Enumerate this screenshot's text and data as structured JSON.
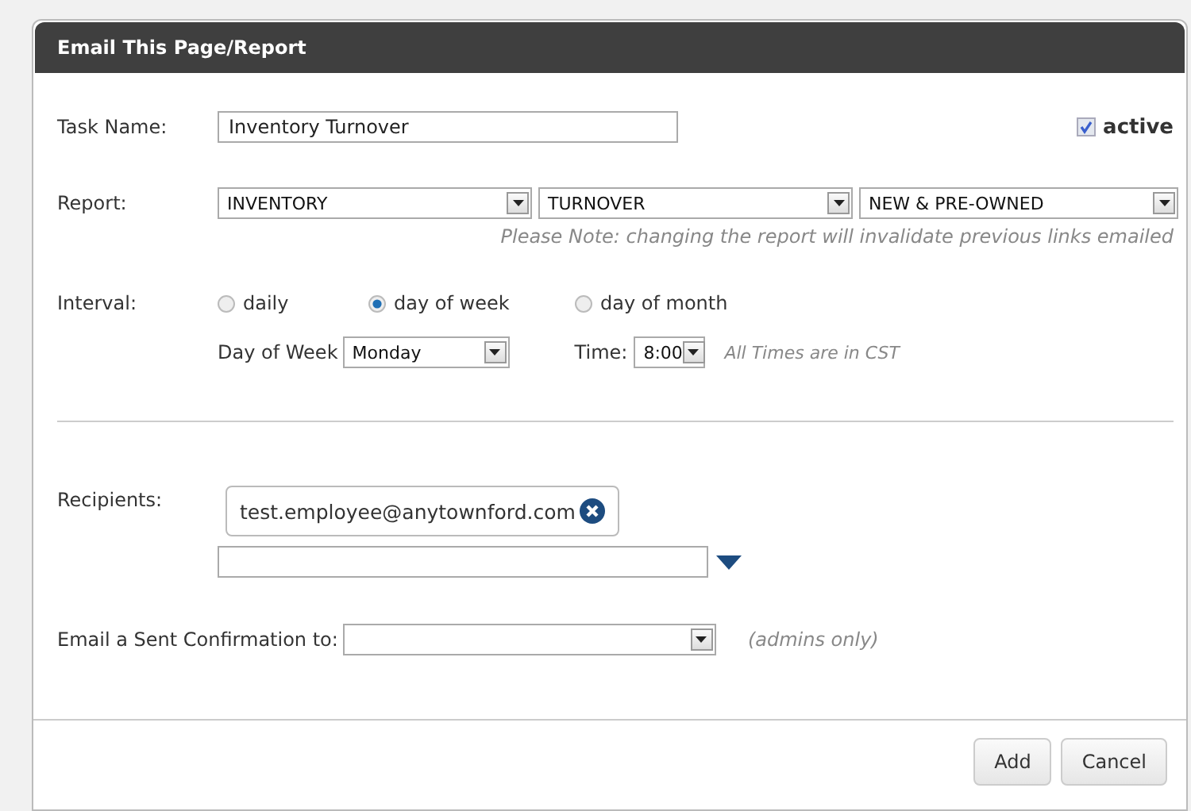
{
  "dialog": {
    "title": "Email This Page/Report"
  },
  "task_name": {
    "label": "Task Name:",
    "value": "Inventory Turnover"
  },
  "active": {
    "label": "active",
    "checked": true
  },
  "report": {
    "label": "Report:",
    "selects": [
      "INVENTORY",
      "TURNOVER",
      "NEW & PRE-OWNED"
    ],
    "note": "Please Note: changing the report will invalidate previous links emailed"
  },
  "interval": {
    "label": "Interval:",
    "options": [
      {
        "label": "daily",
        "selected": false
      },
      {
        "label": "day of week",
        "selected": true
      },
      {
        "label": "day of month",
        "selected": false
      }
    ]
  },
  "day_of_week": {
    "label": "Day of Week",
    "value": "Monday"
  },
  "time": {
    "label": "Time:",
    "value": "8:00",
    "note": "All Times are in CST"
  },
  "recipients": {
    "label": "Recipients:",
    "chips": [
      "test.employee@anytownford.com"
    ]
  },
  "confirmation": {
    "label": "Email a Sent Confirmation to:",
    "note": "(admins only)"
  },
  "buttons": [
    "Add",
    "Cancel"
  ]
}
